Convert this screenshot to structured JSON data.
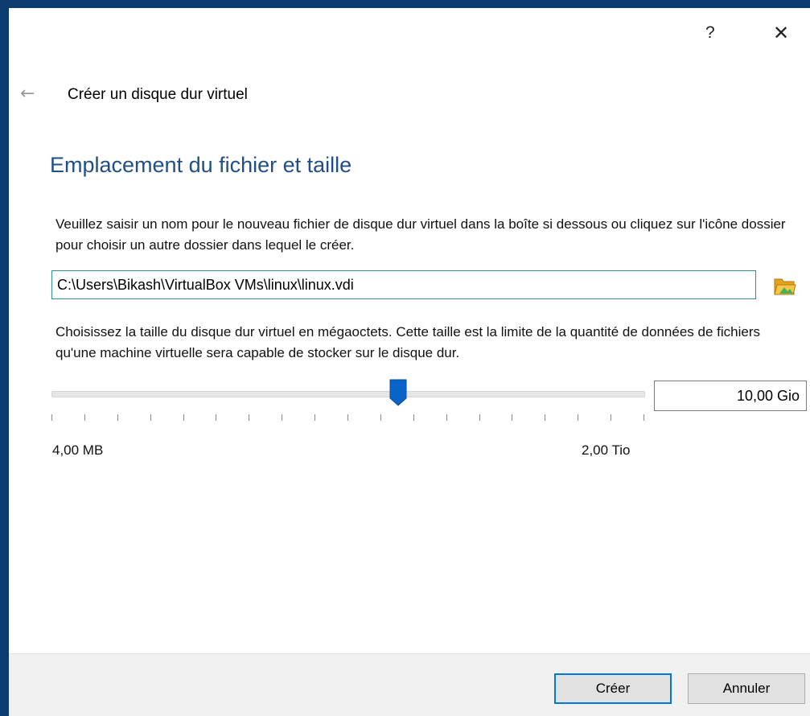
{
  "window": {
    "help_label": "?",
    "close_label": "✕"
  },
  "header": {
    "back_icon": "←",
    "title": "Créer un disque dur virtuel"
  },
  "page": {
    "heading": "Emplacement du fichier et taille",
    "location_description": "Veuillez saisir un nom pour le nouveau fichier de disque dur virtuel dans la boîte si dessous ou cliquez sur l'icône dossier pour choisir un autre dossier dans lequel le créer.",
    "file_path": "C:\\Users\\Bikash\\VirtualBox VMs\\linux\\linux.vdi",
    "size_description": "Choisissez la taille du disque dur virtuel en mégaoctets. Cette taille est la limite de la quantité de données de fichiers qu'une machine virtuelle sera capable de stocker sur le disque dur.",
    "size_value": "10,00 Gio",
    "slider_min_label": "4,00 MB",
    "slider_max_label": "2,00 Tio",
    "slider_fraction": 0.585,
    "tick_count": 19
  },
  "footer": {
    "create_label": "Créer",
    "cancel_label": "Annuler"
  },
  "icons": {
    "folder": "folder-open-icon",
    "accent_color": "#0078d7",
    "heading_color": "#1f4f86"
  }
}
